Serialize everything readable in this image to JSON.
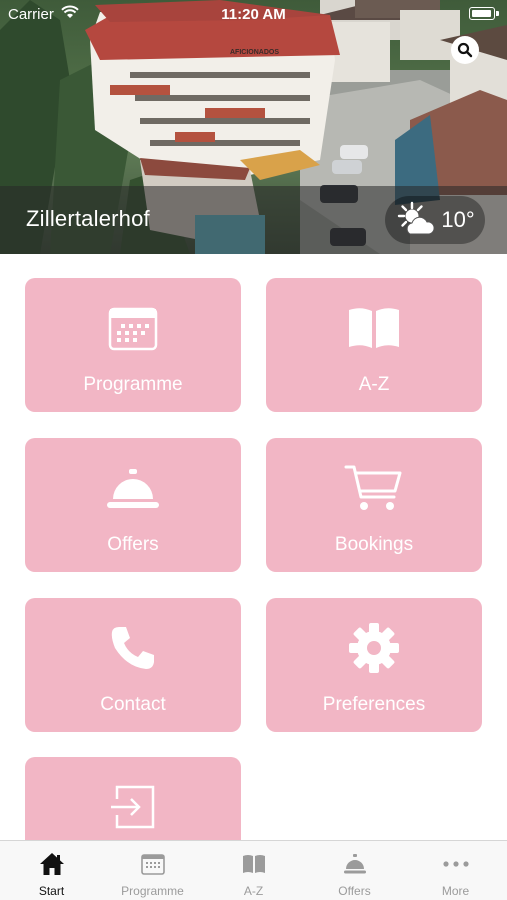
{
  "status_bar": {
    "carrier": "Carrier",
    "time": "11:20 AM"
  },
  "header": {
    "hotel_name": "Zillertalerhof",
    "weather": {
      "icon": "partly-sunny-icon",
      "temperature": "10°"
    },
    "sign_text": "AFICIONADOS"
  },
  "tiles": [
    {
      "label": "Programme",
      "icon": "calendar-icon"
    },
    {
      "label": "A-Z",
      "icon": "book-icon"
    },
    {
      "label": "Offers",
      "icon": "service-bell-icon"
    },
    {
      "label": "Bookings",
      "icon": "shopping-cart-icon"
    },
    {
      "label": "Contact",
      "icon": "phone-icon"
    },
    {
      "label": "Preferences",
      "icon": "gear-icon"
    },
    {
      "label": "",
      "icon": "sign-in-icon"
    }
  ],
  "tabbar": {
    "items": [
      {
        "label": "Start",
        "icon": "home-icon",
        "active": true
      },
      {
        "label": "Programme",
        "icon": "calendar-icon",
        "active": false
      },
      {
        "label": "A-Z",
        "icon": "book-icon",
        "active": false
      },
      {
        "label": "Offers",
        "icon": "service-bell-icon",
        "active": false
      },
      {
        "label": "More",
        "icon": "more-dots-icon",
        "active": false
      }
    ]
  },
  "colors": {
    "tile_bg": "#f2b6c5",
    "tab_active": "#111111",
    "tab_inactive": "#9b9b9b"
  }
}
